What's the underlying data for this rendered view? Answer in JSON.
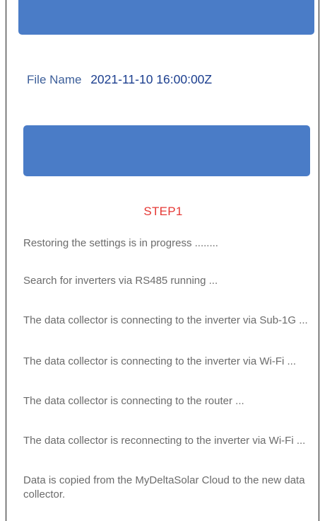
{
  "colors": {
    "accent": "#4a7cc7",
    "step_title": "#e53935",
    "file_value": "#1c3f8f",
    "status_text": "#6b6b6b"
  },
  "top_button": {
    "label": ""
  },
  "file": {
    "label": "File Name",
    "value": "2021-11-10 16:00:00Z"
  },
  "main_button": {
    "label": ""
  },
  "step": {
    "title": "STEP1"
  },
  "status_messages": [
    "Restoring the settings is in progress ........",
    "Search for inverters via RS485 running ...",
    "The data collector is connecting to the inverter via Sub-1G ...",
    "The data collector is connecting to the inverter via Wi-Fi ...",
    "The data collector is connecting to the router ...",
    "The data collector is reconnecting to the inverter via Wi-Fi ...",
    "Data is copied from the MyDeltaSolar Cloud to the new data collector."
  ]
}
